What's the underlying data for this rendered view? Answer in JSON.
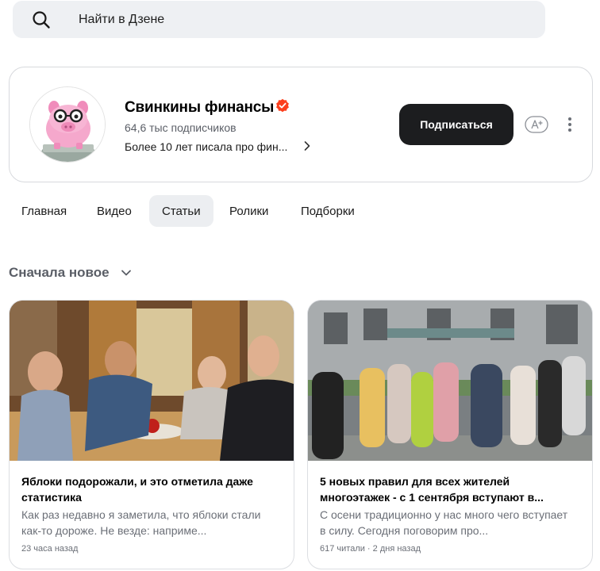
{
  "search": {
    "placeholder": "Найти в Дзене"
  },
  "channel": {
    "title": "Свинкины финансы",
    "subscribers": "64,6 тыс подписчиков",
    "description": "Более 10 лет писала про фин...",
    "subscribe_label": "Подписаться",
    "accent": "#fc3f1d"
  },
  "tabs": [
    {
      "label": "Главная",
      "active": false
    },
    {
      "label": "Видео",
      "active": false
    },
    {
      "label": "Статьи",
      "active": true
    },
    {
      "label": "Ролики",
      "active": false
    },
    {
      "label": "Подборки",
      "active": false
    }
  ],
  "sort": {
    "label": "Сначала новое"
  },
  "articles": [
    {
      "title": "Яблоки подорожали, и это отметила даже статистика",
      "desc": "Как раз недавно я заметила, что яблоки стали как-то дороже. Не везде: наприме...",
      "meta": "23 часа назад"
    },
    {
      "title": "5 новых правил для всех жителей многоэтажек - с 1 сентября вступают в...",
      "desc": "С осени традиционно у нас много чего вступает в силу. Сегодня поговорим про...",
      "meta": "617 читали · 2 дня назад"
    }
  ]
}
